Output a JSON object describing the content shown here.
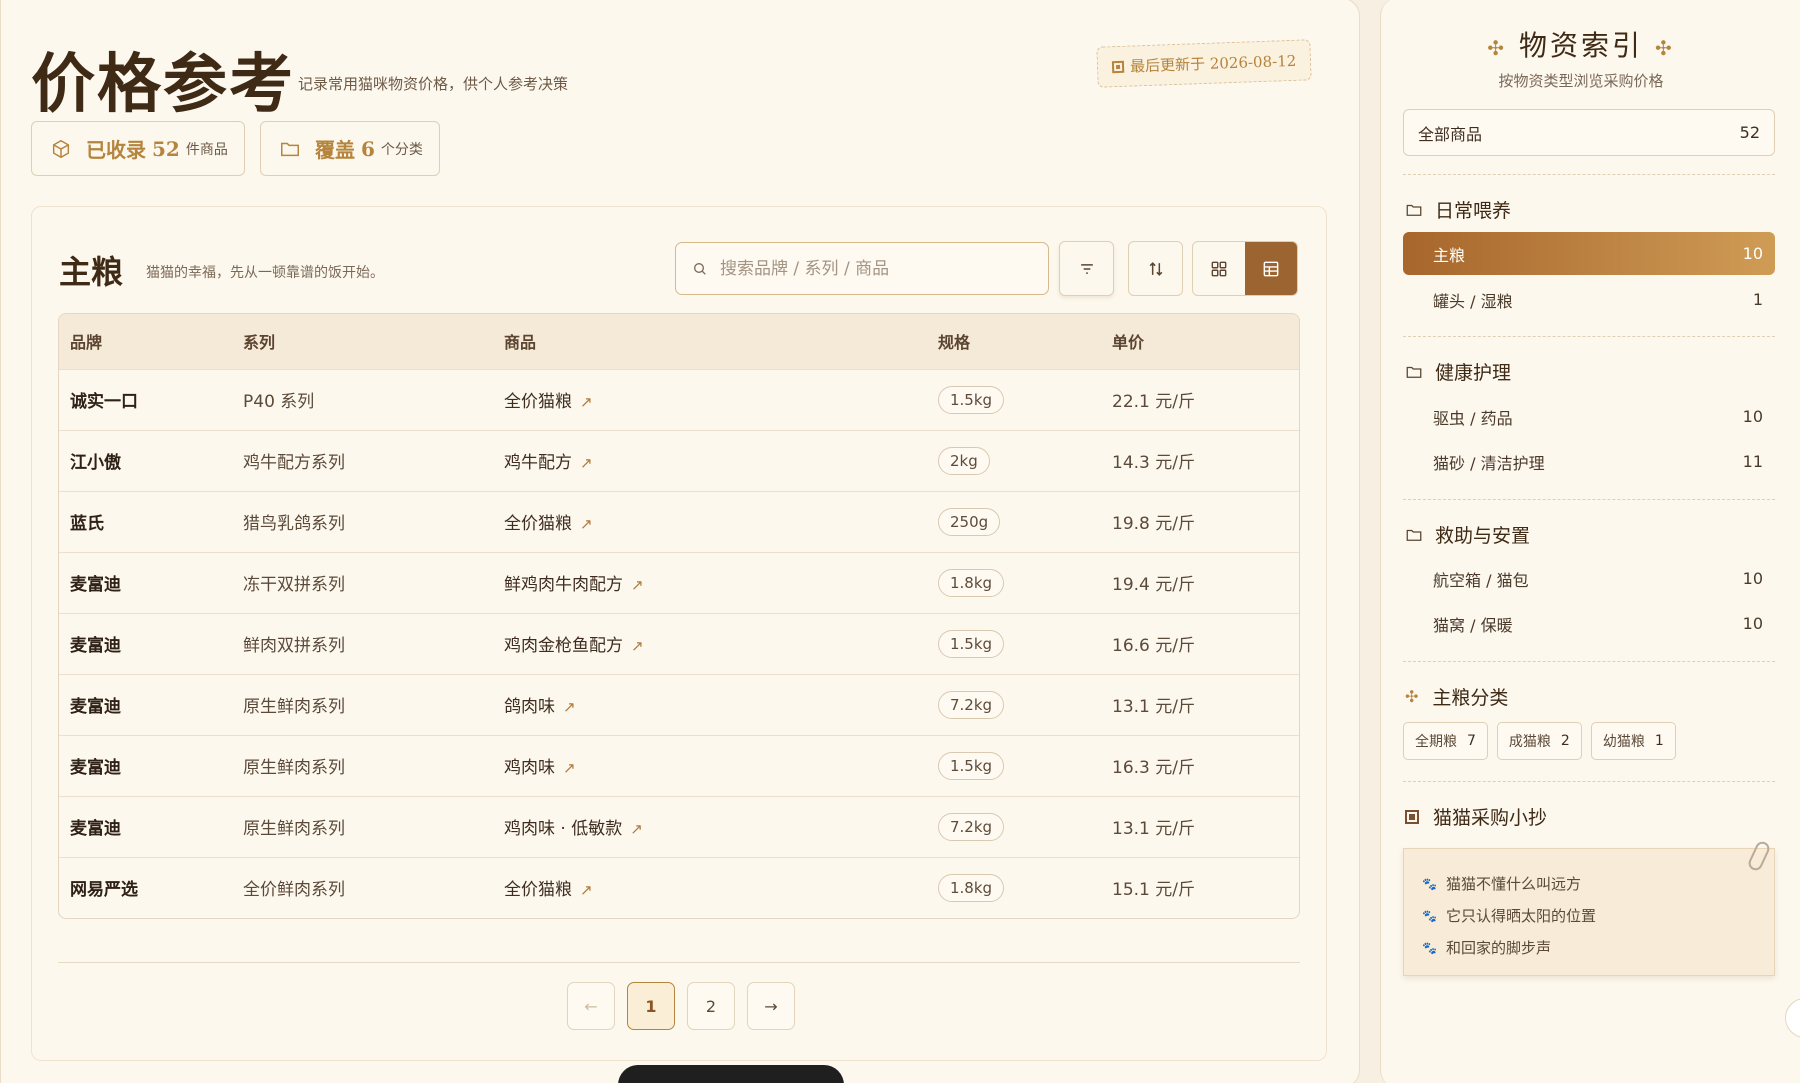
{
  "header": {
    "title": "价格参考",
    "subtitle": "记录常用猫咪物资价格，供个人参考决策",
    "updated": "最后更新于 2026-08-12"
  },
  "stats": [
    {
      "label": "已收录",
      "value": "52",
      "unit": "件商品",
      "icon": "box-icon"
    },
    {
      "label": "覆盖",
      "value": "6",
      "unit": "个分类",
      "icon": "folder-icon"
    }
  ],
  "section": {
    "title": "主粮",
    "desc": "猫猫的幸福，先从一顿靠谱的饭开始。",
    "search_placeholder": "搜索品牌 / 系列 / 商品"
  },
  "table": {
    "columns": [
      "品牌",
      "系列",
      "商品",
      "规格",
      "单价"
    ],
    "rows": [
      {
        "brand": "诚实一口",
        "series": "P40 系列",
        "product": "全价猫粮",
        "spec": "1.5kg",
        "price": "22.1 元/斤"
      },
      {
        "brand": "江小傲",
        "series": "鸡牛配方系列",
        "product": "鸡牛配方",
        "spec": "2kg",
        "price": "14.3 元/斤"
      },
      {
        "brand": "蓝氏",
        "series": "猎鸟乳鸽系列",
        "product": "全价猫粮",
        "spec": "250g",
        "price": "19.8 元/斤"
      },
      {
        "brand": "麦富迪",
        "series": "冻干双拼系列",
        "product": "鲜鸡肉牛肉配方",
        "spec": "1.8kg",
        "price": "19.4 元/斤"
      },
      {
        "brand": "麦富迪",
        "series": "鲜肉双拼系列",
        "product": "鸡肉金枪鱼配方",
        "spec": "1.5kg",
        "price": "16.6 元/斤"
      },
      {
        "brand": "麦富迪",
        "series": "原生鲜肉系列",
        "product": "鸽肉味",
        "spec": "7.2kg",
        "price": "13.1 元/斤"
      },
      {
        "brand": "麦富迪",
        "series": "原生鲜肉系列",
        "product": "鸡肉味",
        "spec": "1.5kg",
        "price": "16.3 元/斤"
      },
      {
        "brand": "麦富迪",
        "series": "原生鲜肉系列",
        "product": "鸡肉味 · 低敏款",
        "spec": "7.2kg",
        "price": "13.1 元/斤"
      },
      {
        "brand": "网易严选",
        "series": "全价鲜肉系列",
        "product": "全价猫粮",
        "spec": "1.8kg",
        "price": "15.1 元/斤"
      }
    ],
    "link_glyph": "↗"
  },
  "pager": {
    "prev": "←",
    "pages": [
      "1",
      "2"
    ],
    "current": "1",
    "next": "→"
  },
  "sidebar": {
    "title": "物资索引",
    "subtitle": "按物资类型浏览采购价格",
    "all": {
      "label": "全部商品",
      "count": "52"
    },
    "groups": [
      {
        "title": "日常喂养",
        "items": [
          {
            "label": "主粮",
            "count": "10",
            "active": true
          },
          {
            "label": "罐头 / 湿粮",
            "count": "1"
          }
        ]
      },
      {
        "title": "健康护理",
        "items": [
          {
            "label": "驱虫 / 药品",
            "count": "10"
          },
          {
            "label": "猫砂 / 清洁护理",
            "count": "11"
          }
        ]
      },
      {
        "title": "救助与安置",
        "items": [
          {
            "label": "航空箱 / 猫包",
            "count": "10"
          },
          {
            "label": "猫窝 / 保暖",
            "count": "10"
          }
        ]
      }
    ],
    "staple_title": "主粮分类",
    "chips": [
      {
        "label": "全期粮",
        "count": "7"
      },
      {
        "label": "成猫粮",
        "count": "2"
      },
      {
        "label": "幼猫粮",
        "count": "1"
      }
    ],
    "note_title": "猫猫采购小抄",
    "note_lines": [
      "猫猫不懂什么叫远方",
      "它只认得晒太阳的位置",
      "和回家的脚步声"
    ]
  },
  "colors": {
    "accent": "#b5843d",
    "active_view": "#9c6431",
    "background": "#f7efe2"
  }
}
